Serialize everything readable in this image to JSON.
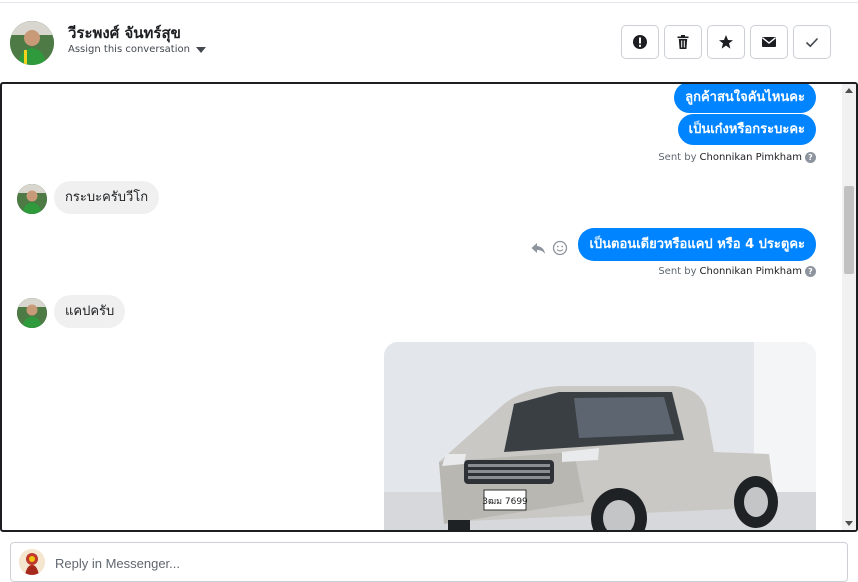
{
  "header": {
    "contact_name": "วีระพงศ์ จันทร์สุข",
    "assign_label": "Assign this conversation",
    "actions": [
      {
        "icon": "alert-icon",
        "name": "mark-spam-button"
      },
      {
        "icon": "trash-icon",
        "name": "delete-button"
      },
      {
        "icon": "star-icon",
        "name": "star-button"
      },
      {
        "icon": "envelope-icon",
        "name": "mark-unread-button"
      },
      {
        "icon": "check-icon",
        "name": "mark-done-button"
      }
    ]
  },
  "messages": {
    "out_1": "ลูกค้าสนใจคันไหนคะ",
    "out_2": "เป็นเก๋งหรือกระบะคะ",
    "sent_by_prefix": "Sent by",
    "sender_1": "Chonnikan Pimkham",
    "in_1": "กระบะครับวีโก",
    "out_3": "เป็นตอนเดียวหรือแคป หรือ 4 ประตูคะ",
    "sender_2": "Chonnikan Pimkham",
    "in_2": "แคปครับ",
    "plate_text": "3ฒม 7699"
  },
  "reply": {
    "placeholder": "Reply in Messenger..."
  },
  "colors": {
    "accent": "#0084ff",
    "incoming_bubble": "#f0f0f0",
    "border": "#ccd0d5"
  }
}
